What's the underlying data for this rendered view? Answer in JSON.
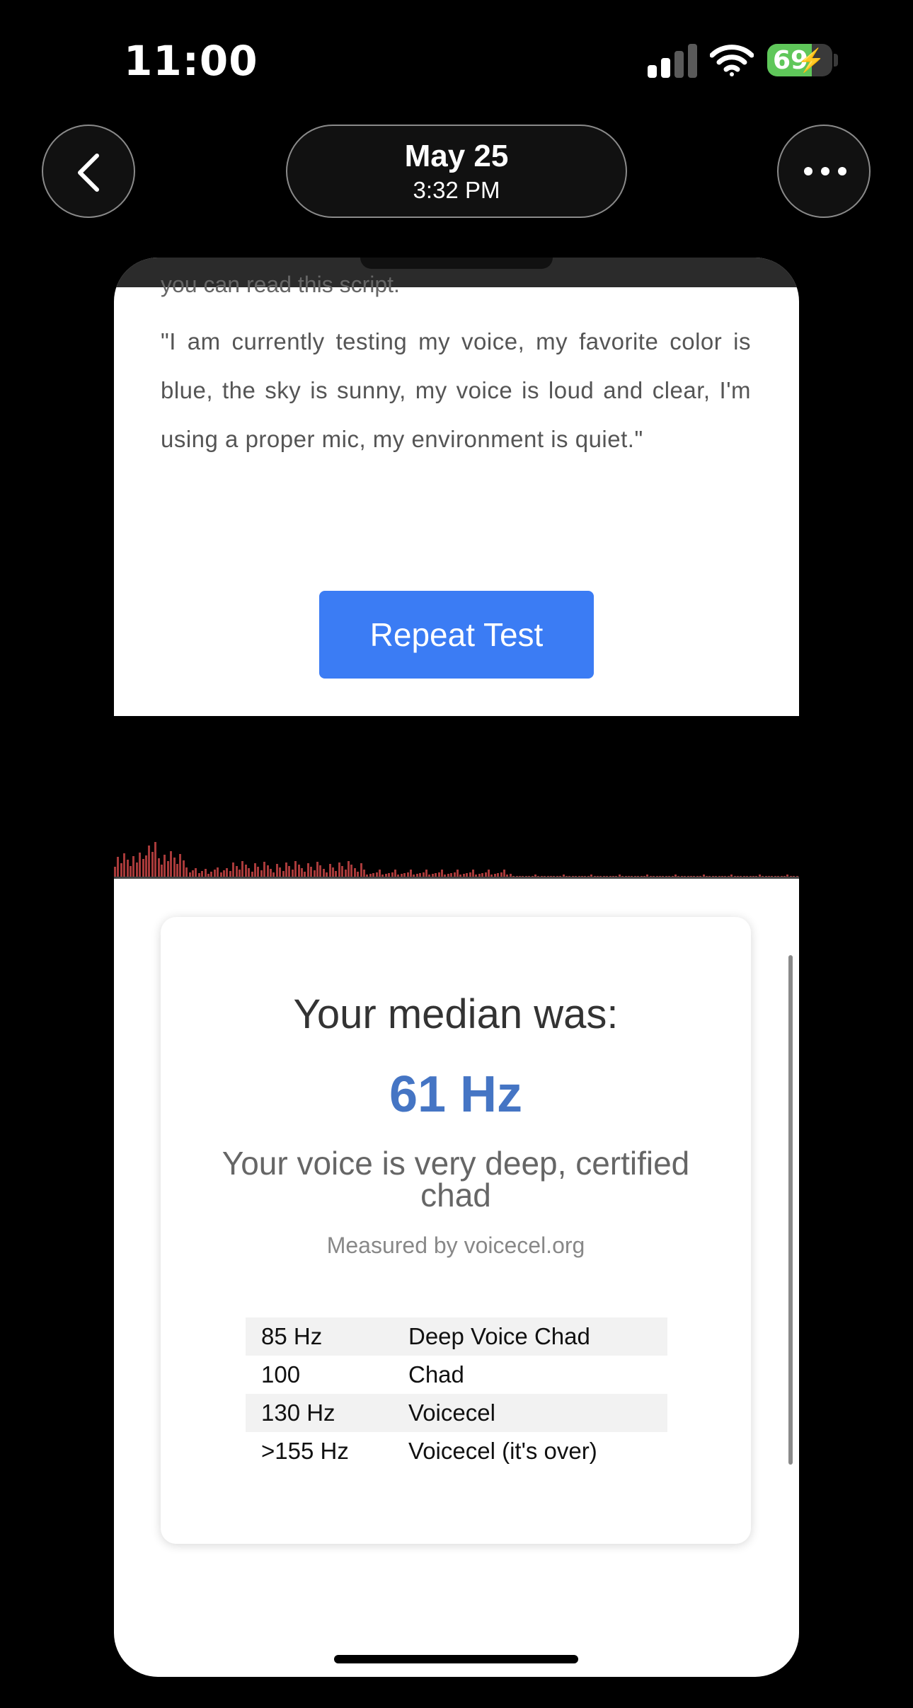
{
  "status_bar": {
    "time": "11:00",
    "battery_percent": "69",
    "battery_level": 0.69,
    "icons": [
      "signal-icon",
      "wifi-icon",
      "battery-icon",
      "charging-bolt-icon"
    ]
  },
  "nav": {
    "back_icon": "chevron-left-icon",
    "more_icon": "ellipsis-icon",
    "date": "May 25",
    "time": "3:32 PM"
  },
  "script": {
    "cut_line": "you can read this script.",
    "quote": "\"I am currently testing my voice, my favorite color is blue, the sky is sunny, my voice is loud and clear, I'm using a proper mic, my environment is quiet.\""
  },
  "actions": {
    "repeat_label": "Repeat Test"
  },
  "result": {
    "median_label": "Your median was:",
    "median_value": "61 Hz",
    "verdict": "Your voice is very deep, certified chad",
    "measured_by": "Measured by voicecel.org"
  },
  "reference_table": [
    {
      "freq": "85 Hz",
      "label": "Deep Voice Chad"
    },
    {
      "freq": "100",
      "label": "Chad"
    },
    {
      "freq": "130 Hz",
      "label": "Voicecel"
    },
    {
      "freq": ">155 Hz",
      "label": "Voicecel (it's over)"
    }
  ],
  "colors": {
    "accent_blue": "#3b7cf4",
    "median_blue": "#4575c4",
    "visualizer_bar": "#a83a3a",
    "battery_green": "#5fc75a"
  }
}
